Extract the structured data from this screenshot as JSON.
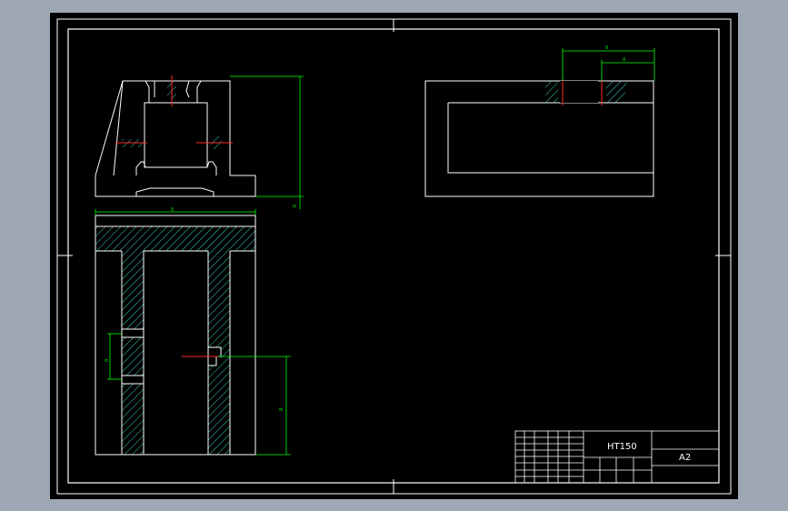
{
  "drawing": {
    "material": "HT150",
    "sheet_size": "A2"
  },
  "dimensions": {
    "side_view_height": "0",
    "plan_width": "0",
    "hole_spacing": "0",
    "offset_height": "0",
    "section_width": "0",
    "section_inner": "0"
  },
  "title_block": {
    "cells": [
      "",
      "",
      "",
      "",
      "",
      "",
      "",
      "",
      "",
      "",
      ""
    ]
  }
}
